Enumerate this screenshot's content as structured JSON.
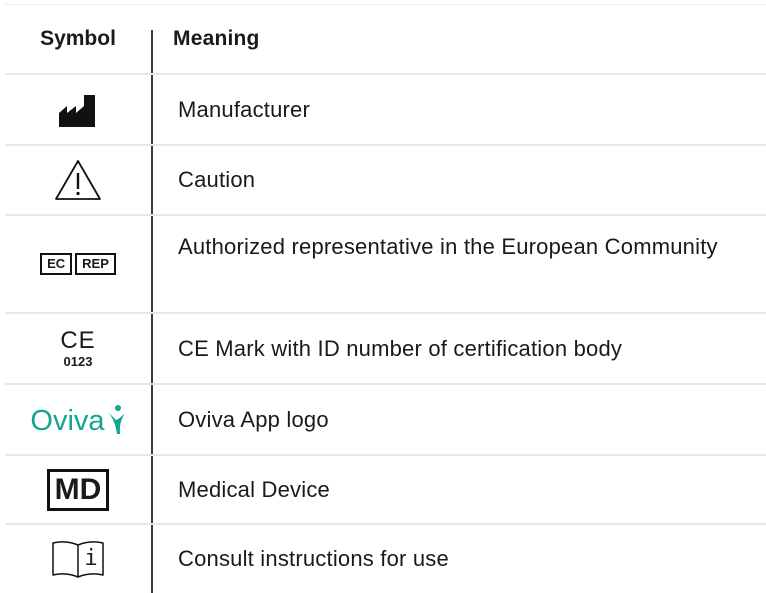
{
  "table": {
    "header": {
      "symbol": "Symbol",
      "meaning": "Meaning"
    },
    "rows": [
      {
        "icon": "manufacturer-icon",
        "meaning": "Manufacturer"
      },
      {
        "icon": "caution-icon",
        "meaning": "Caution"
      },
      {
        "icon": "ec-rep-icon",
        "icon_text": [
          "EC",
          "REP"
        ],
        "meaning": "Authorized representative in the European Community"
      },
      {
        "icon": "ce-mark-icon",
        "icon_text": [
          "CE",
          "0123"
        ],
        "meaning": "CE Mark with ID number of certification body"
      },
      {
        "icon": "oviva-logo-icon",
        "icon_text": "Oviva",
        "brand_color": "#15a48f",
        "meaning": "Oviva App logo"
      },
      {
        "icon": "medical-device-icon",
        "icon_text": "MD",
        "meaning": "Medical Device"
      },
      {
        "icon": "consult-instructions-icon",
        "icon_text": "i",
        "meaning": "Consult instructions for use"
      }
    ]
  }
}
